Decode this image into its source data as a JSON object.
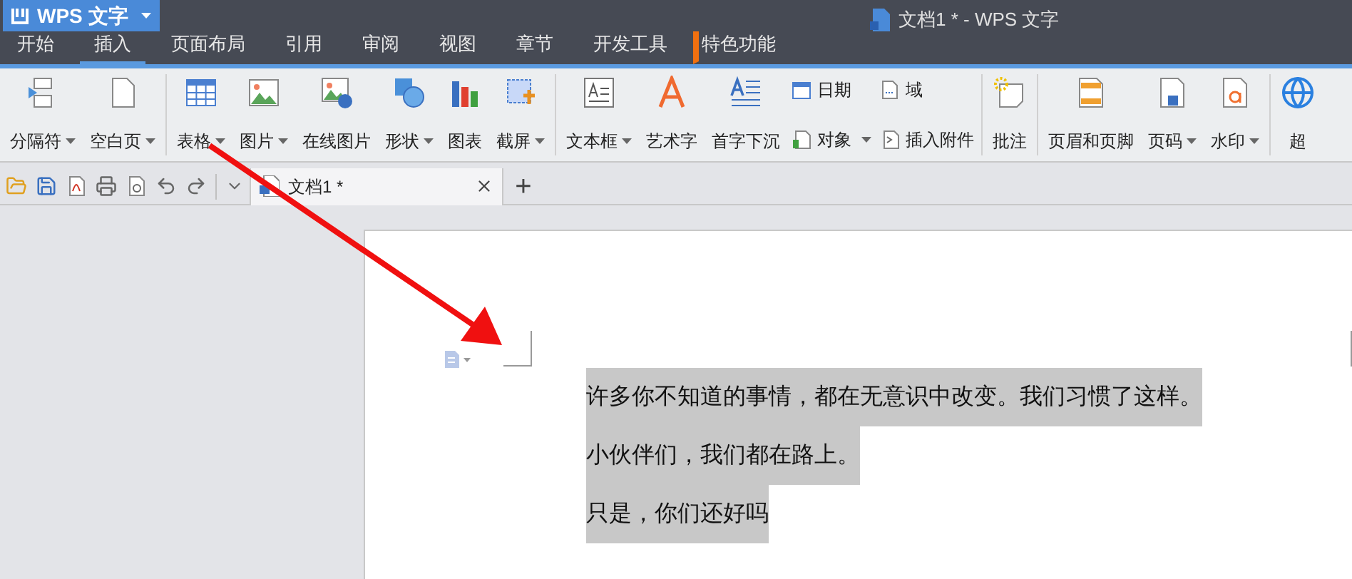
{
  "app_button": {
    "label": "WPS 文字"
  },
  "window": {
    "title": "文档1 * - WPS 文字"
  },
  "tabs": [
    {
      "label": "开始",
      "selected": false,
      "marked": false
    },
    {
      "label": "插入",
      "selected": true,
      "marked": false
    },
    {
      "label": "页面布局",
      "selected": false,
      "marked": false
    },
    {
      "label": "引用",
      "selected": false,
      "marked": false
    },
    {
      "label": "审阅",
      "selected": false,
      "marked": false
    },
    {
      "label": "视图",
      "selected": false,
      "marked": false
    },
    {
      "label": "章节",
      "selected": false,
      "marked": false
    },
    {
      "label": "开发工具",
      "selected": false,
      "marked": false
    },
    {
      "label": "特色功能",
      "selected": false,
      "marked": true
    }
  ],
  "ribbon": {
    "groups": [
      {
        "items": [
          {
            "kind": "large",
            "label": "分隔符",
            "dropdown": true
          },
          {
            "kind": "large",
            "label": "空白页",
            "dropdown": true
          }
        ]
      },
      {
        "items": [
          {
            "kind": "large",
            "label": "表格",
            "dropdown": true
          },
          {
            "kind": "large",
            "label": "图片",
            "dropdown": true
          },
          {
            "kind": "large",
            "label": "在线图片",
            "dropdown": false
          },
          {
            "kind": "large",
            "label": "形状",
            "dropdown": true
          },
          {
            "kind": "large",
            "label": "图表",
            "dropdown": false
          },
          {
            "kind": "large",
            "label": "截屏",
            "dropdown": true
          }
        ]
      },
      {
        "items": [
          {
            "kind": "large",
            "label": "文本框",
            "dropdown": true
          },
          {
            "kind": "large",
            "label": "艺术字",
            "dropdown": false
          },
          {
            "kind": "large",
            "label": "首字下沉",
            "dropdown": false
          },
          {
            "kind": "stack",
            "buttons": [
              {
                "label": "日期",
                "dropdown": false
              },
              {
                "label": "对象",
                "dropdown": true
              }
            ]
          },
          {
            "kind": "stack",
            "buttons": [
              {
                "label": "域",
                "dropdown": false
              },
              {
                "label": "插入附件",
                "dropdown": false
              }
            ]
          }
        ]
      },
      {
        "items": [
          {
            "kind": "large",
            "label": "批注",
            "dropdown": false
          }
        ]
      },
      {
        "items": [
          {
            "kind": "large",
            "label": "页眉和页脚",
            "dropdown": false
          },
          {
            "kind": "large",
            "label": "页码",
            "dropdown": true
          },
          {
            "kind": "large",
            "label": "水印",
            "dropdown": true
          }
        ]
      },
      {
        "items": [
          {
            "kind": "large",
            "label": "超",
            "dropdown": false
          }
        ]
      }
    ]
  },
  "doc_tabs": [
    {
      "title": "文档1 *",
      "selected": true
    }
  ],
  "new_tab": "+",
  "document": {
    "lines": [
      {
        "text": "许多你不知道的事情，都在无意识中改变。我们习惯了这样。",
        "selected": true
      },
      {
        "text": "小伙伴们，我们都在路上。",
        "selected": true
      },
      {
        "text": "只是，你们还好吗",
        "selected": true
      }
    ]
  }
}
